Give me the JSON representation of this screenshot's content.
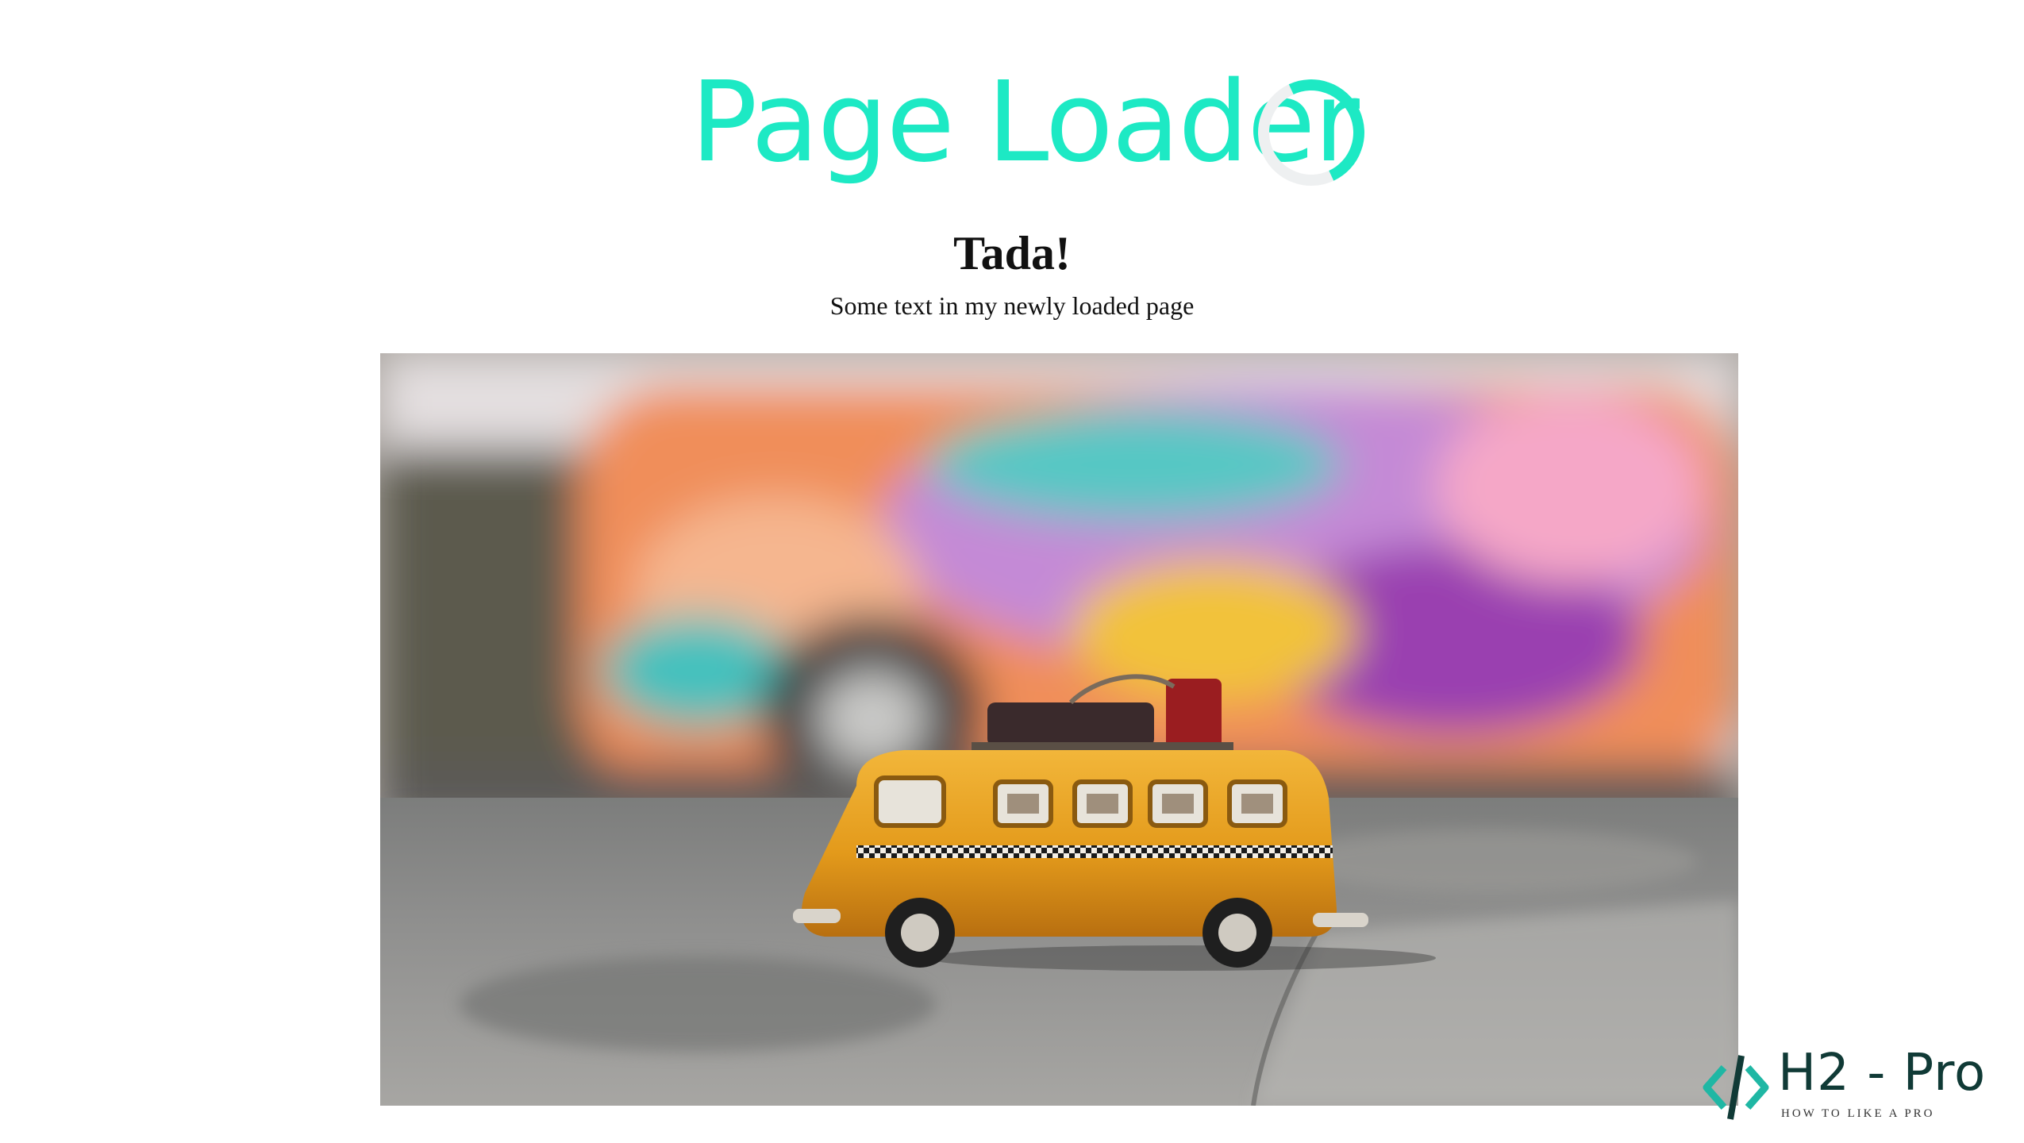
{
  "header": {
    "title": "Page Loader"
  },
  "loader": {
    "icon": "spinner-icon",
    "accent_color": "#1de9c4",
    "track_color": "#eef0f1"
  },
  "content": {
    "heading": "Tada!",
    "text": "Some text in my newly loaded page"
  },
  "watermark": {
    "name": "H2 - Pro",
    "tagline": "HOW TO LIKE A PRO",
    "icon": "code-brackets-icon"
  }
}
